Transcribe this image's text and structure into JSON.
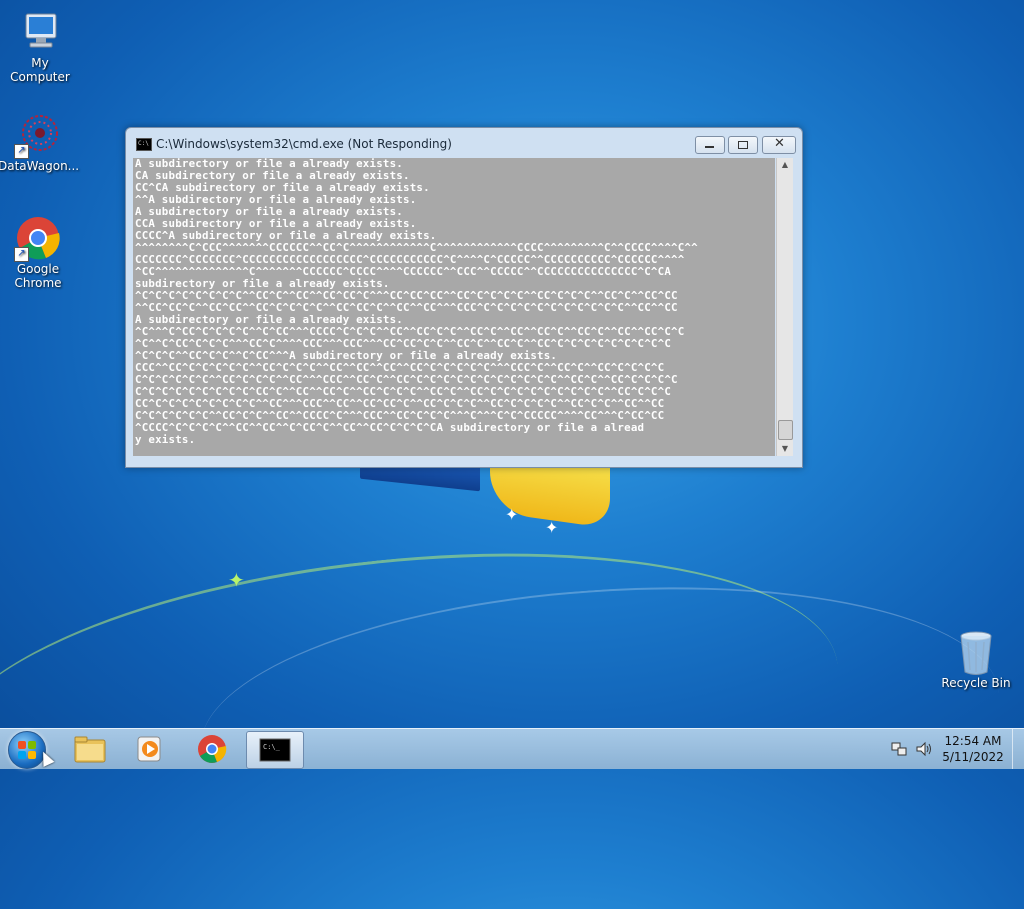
{
  "desktop": {
    "icons": [
      {
        "label": "My Computer",
        "icon": "computer-icon"
      },
      {
        "label": "DataWagon...",
        "icon": "datawagon-icon"
      },
      {
        "label": "Google Chrome",
        "icon": "chrome-icon"
      },
      {
        "label": "Recycle Bin",
        "icon": "recycle-bin-icon"
      }
    ]
  },
  "window": {
    "title": "C:\\Windows\\system32\\cmd.exe (Not Responding)",
    "console_lines": [
      "A subdirectory or file a already exists.",
      "CA subdirectory or file a already exists.",
      "CC^CA subdirectory or file a already exists.",
      "^^A subdirectory or file a already exists.",
      "A subdirectory or file a already exists.",
      "CCA subdirectory or file a already exists.",
      "CCCC^A subdirectory or file a already exists.",
      "^^^^^^^^C^CCC^^^^^^^CCCCCC^^CC^C^^^^^^^^^^^^C^^^^^^^^^^^^CCCC^^^^^^^^^C^^CCCC^^^^C^^",
      "CCCCCCC^CCCCCCC^CCCCCCCCCCCCCCCCCC^CCCCCCCCCCC^C^^^^C^CCCCC^^CCCCCCCCCC^CCCCCC^^^^",
      "^CC^^^^^^^^^^^^^^C^^^^^^^CCCCCC^CCCC^^^^CCCCCC^^CCC^^CCCCC^^CCCCCCCCCCCCCCC^C^CA",
      "subdirectory or file a already exists.",
      "^C^C^C^C^C^C^C^C^^CC^C^^CC^^CC^CC^C^^^CC^CC^CC^^CC^C^C^C^C^^CC^C^C^C^^CC^C^^CC^CC",
      "^^CC^CC^C^^CC^CC^^CC^C^C^C^C^^CC^CC^C^^CC^^CC^^^CCC^C^C^C^C^C^C^C^C^C^C^C^^CC^^CC",
      "A subdirectory or file a already exists.",
      "^C^^^C^CC^C^C^C^C^^C^CC^^^CCCC^C^C^C^^CC^^CC^C^C^^CC^C^^CC^^CC^C^^CC^C^^CC^^CC^C^C",
      "^C^^C^CC^C^C^C^^^CC^C^^^^CCC^^^CCC^^^CC^CC^C^C^^CC^C^^CC^C^^CC^C^C^C^C^C^C^C^C^C",
      "^C^C^C^^CC^C^C^^C^CC^^^A subdirectory or file a already exists.",
      "CCC^^CC^C^C^C^C^C^^CC^C^C^C^^CC^^CC^^CC^^CC^C^C^C^C^C^^^CCC^C^^CC^C^^CC^C^C^C^C",
      "C^C^C^C^C^C^^CC^C^C^C^^CC^^^CCC^^CC^C^^CC^C^C^C^C^C^C^C^C^C^C^C^^CC^C^^CC^C^C^C^C",
      "C^C^C^C^C^C^C^C^C^CC^C^^CC^^CC^C^^CC^C^C^C^^CC^C^^CC^C^C^C^C^C^C^C^C^C^^CC^C^C^C",
      "CC^C^C^C^C^C^C^C^C^^CC^^^CCC^^CC^^CC^CC^C^^CC^C^C^C^^CC^C^C^C^C^^CC^C^C^^CC^^CC",
      "C^C^C^C^C^C^^CC^C^C^^CC^^CCCC^C^^^CCC^^CC^C^C^C^^^C^^^C^C^CCCCC^^^^CC^^^C^CC^CC",
      "^CCCC^C^C^C^C^^CC^^CC^^C^CC^C^^CC^^CC^C^C^C^CA subdirectory or file a alread",
      "y exists."
    ]
  },
  "taskbar": {
    "pinned": [
      {
        "name": "start-button",
        "icon": "windows-logo-icon"
      },
      {
        "name": "explorer",
        "icon": "folder-icon"
      },
      {
        "name": "media-player",
        "icon": "media-player-icon"
      },
      {
        "name": "chrome",
        "icon": "chrome-icon"
      },
      {
        "name": "cmd",
        "icon": "cmd-icon",
        "active": true
      }
    ],
    "clock": {
      "time": "12:54 AM",
      "date": "5/11/2022"
    }
  },
  "colors": {
    "console_bg": "#a8a8a8",
    "console_fg": "#ffffff",
    "desktop_blue": "#1e7fd0"
  }
}
